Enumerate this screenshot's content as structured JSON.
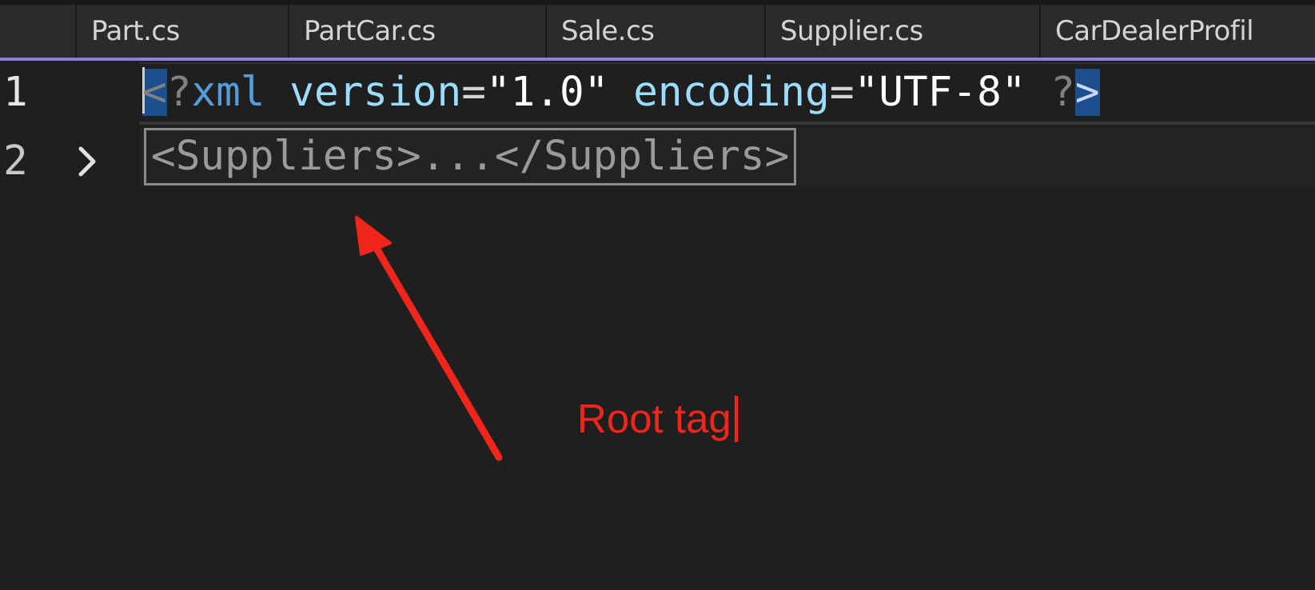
{
  "tabs": [
    {
      "label": "Part.cs"
    },
    {
      "label": "PartCar.cs"
    },
    {
      "label": "Sale.cs"
    },
    {
      "label": "Supplier.cs"
    },
    {
      "label": "CarDealerProfil"
    }
  ],
  "colors": {
    "tab_accent": "#8a7ed8",
    "annotation": "#f0251c",
    "bracket_match": "#1d4f8f"
  },
  "editor": {
    "lines": [
      {
        "number": "1",
        "open_bracket": "<",
        "pi_q1": "?",
        "pi_name": "xml",
        "attr1_name": "version",
        "attr1_eq": "=",
        "attr1_value": "\"1.0\"",
        "attr2_name": "encoding",
        "attr2_eq": "=",
        "attr2_value": "\"UTF-8\"",
        "pi_q2": "?",
        "close_bracket": ">"
      },
      {
        "number": "2",
        "fold_icon": "chevron-right-icon",
        "collapsed_text": "<Suppliers>...</Suppliers>"
      }
    ]
  },
  "annotation": {
    "text": "Root tag",
    "arrow_icon": "arrow-icon"
  }
}
